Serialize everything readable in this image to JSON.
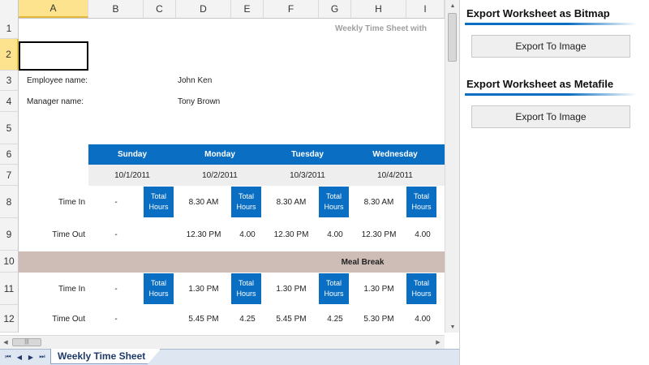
{
  "spreadsheet": {
    "columns": [
      "A",
      "B",
      "C",
      "D",
      "E",
      "F",
      "G",
      "H",
      "I"
    ],
    "rows": [
      "1",
      "2",
      "3",
      "4",
      "5",
      "6",
      "7",
      "8",
      "9",
      "10",
      "11",
      "12"
    ],
    "title": "Weekly Time Sheet with",
    "employee_label": "Employee name:",
    "employee_value": "John Ken",
    "manager_label": "Manager name:",
    "manager_value": "Tony Brown",
    "days": [
      "Sunday",
      "Monday",
      "Tuesday",
      "Wednesday"
    ],
    "dates": [
      "10/1/2011",
      "10/2/2011",
      "10/3/2011",
      "10/4/2011"
    ],
    "time_in_label": "Time In",
    "time_out_label": "Time Out",
    "total_hours_label": "Total Hours",
    "meal_break_label": "Meal Break",
    "row8_values": [
      "-",
      "8.30 AM",
      "8.30 AM",
      "8.30 AM"
    ],
    "row9_values": [
      "-",
      "12.30 PM",
      "4.00",
      "12.30 PM",
      "4.00",
      "12.30 PM",
      "4.00"
    ],
    "row11_values": [
      "-",
      "1.30 PM",
      "1.30 PM",
      "1.30 PM"
    ],
    "row12_values": [
      "-",
      "5.45 PM",
      "4.25",
      "5.45 PM",
      "4.25",
      "5.30 PM",
      "4.00"
    ]
  },
  "tabs": {
    "active": "Weekly Time Sheet"
  },
  "panel": {
    "section1_title": "Export Worksheet as Bitmap",
    "section1_button": "Export To Image",
    "section2_title": "Export Worksheet as Metafile",
    "section2_button": "Export To Image"
  },
  "colors": {
    "header_blue": "#0a6fc2",
    "meal_break_bg": "#cdbdb6",
    "selection_yellow": "#fde38e"
  }
}
